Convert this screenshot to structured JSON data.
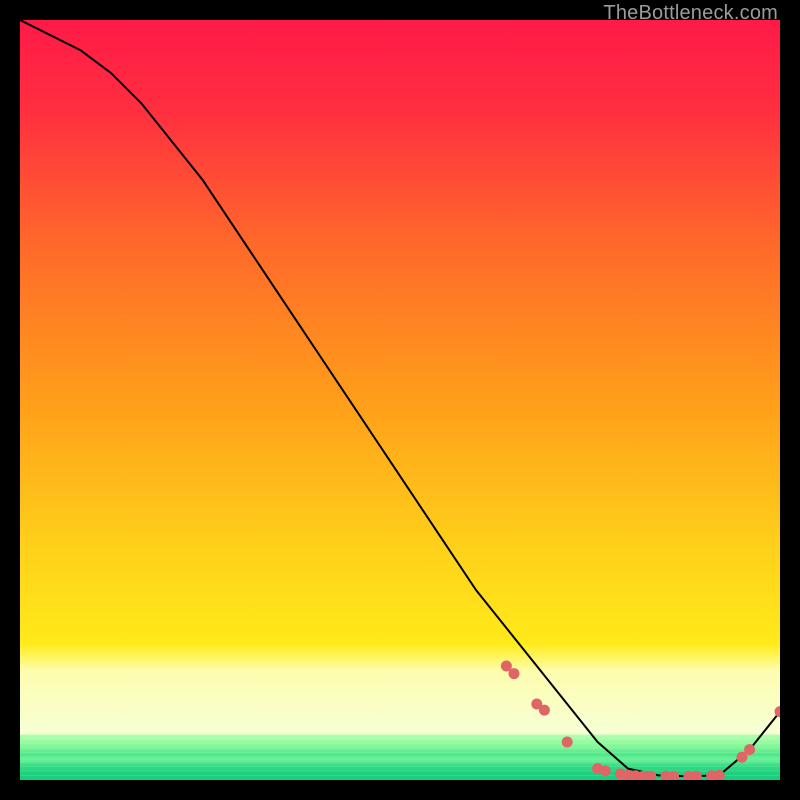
{
  "attribution": "TheBottleneck.com",
  "chart_data": {
    "type": "line",
    "title": "",
    "xlabel": "",
    "ylabel": "",
    "xlim": [
      0,
      100
    ],
    "ylim": [
      0,
      100
    ],
    "x": [
      0,
      4,
      8,
      12,
      16,
      20,
      24,
      28,
      32,
      36,
      40,
      44,
      48,
      52,
      56,
      60,
      64,
      68,
      72,
      76,
      80,
      84,
      88,
      92,
      96,
      100
    ],
    "values": [
      100,
      98,
      96,
      93,
      89,
      84,
      79,
      73,
      67,
      61,
      55,
      49,
      43,
      37,
      31,
      25,
      20,
      15,
      10,
      5,
      1.5,
      0.6,
      0.5,
      0.6,
      4,
      9
    ],
    "marker_points": {
      "x": [
        64,
        65,
        68,
        69,
        72,
        76,
        77,
        79,
        80,
        81,
        82,
        83,
        85,
        86,
        88,
        89,
        91,
        92,
        95,
        96,
        100
      ],
      "y": [
        15,
        14,
        10,
        9.2,
        5,
        1.5,
        1.2,
        0.8,
        0.6,
        0.55,
        0.5,
        0.5,
        0.5,
        0.5,
        0.5,
        0.5,
        0.55,
        0.6,
        3,
        4,
        9
      ]
    },
    "marker_color": "#e06666",
    "line_color": "#000000",
    "green_band_top": 6,
    "yellow_band_top": 18
  }
}
